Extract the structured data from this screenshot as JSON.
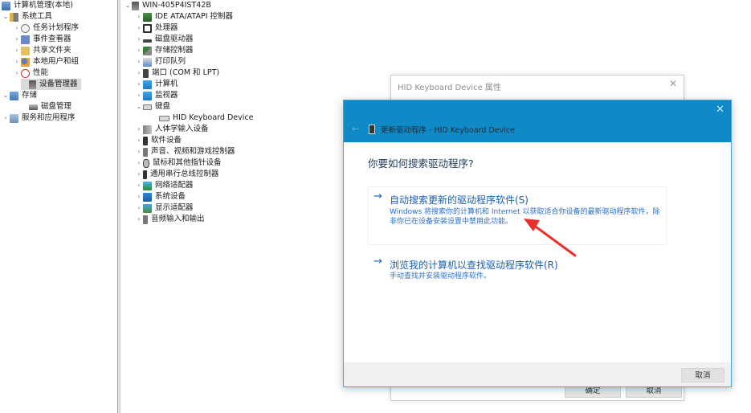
{
  "left_tree": {
    "root": "计算机管理(本地)",
    "items": [
      {
        "label": "系统工具",
        "expanded": true
      },
      {
        "label": "任务计划程序"
      },
      {
        "label": "事件查看器"
      },
      {
        "label": "共享文件夹"
      },
      {
        "label": "本地用户和组"
      },
      {
        "label": "性能"
      },
      {
        "label": "设备管理器",
        "selected": true
      },
      {
        "label": "存储",
        "expanded": true
      },
      {
        "label": "磁盘管理"
      },
      {
        "label": "服务和应用程序"
      }
    ]
  },
  "device_tree": {
    "root": "WIN-405P4IST42B",
    "items": [
      {
        "label": "IDE ATA/ATAPI 控制器"
      },
      {
        "label": "处理器"
      },
      {
        "label": "磁盘驱动器"
      },
      {
        "label": "存储控制器"
      },
      {
        "label": "打印队列"
      },
      {
        "label": "端口 (COM 和 LPT)"
      },
      {
        "label": "计算机"
      },
      {
        "label": "监视器"
      },
      {
        "label": "键盘",
        "expanded": true
      },
      {
        "label": "HID Keyboard Device"
      },
      {
        "label": "人体学输入设备"
      },
      {
        "label": "软件设备"
      },
      {
        "label": "声音、视频和游戏控制器"
      },
      {
        "label": "鼠标和其他指针设备"
      },
      {
        "label": "通用串行总线控制器"
      },
      {
        "label": "网络适配器"
      },
      {
        "label": "系统设备"
      },
      {
        "label": "显示适配器"
      },
      {
        "label": "音频输入和输出"
      }
    ]
  },
  "properties_dialog": {
    "title": "HID Keyboard Device 属性",
    "close": "✕",
    "ok_label": "确定",
    "cancel_label": "取消"
  },
  "update_dialog": {
    "title": "更新驱动程序 - HID Keyboard Device",
    "close": "✕",
    "back": "←",
    "question": "你要如何搜索驱动程序?",
    "options": [
      {
        "arrow": "→",
        "title": "自动搜索更新的驱动程序软件(S)",
        "desc": "Windows 将搜索你的计算机和 Internet 以获取适合你设备的最新驱动程序软件，除非你已在设备安装设置中禁用此功能。"
      },
      {
        "arrow": "→",
        "title": "浏览我的计算机以查找驱动程序软件(R)",
        "desc": "手动查找并安装驱动程序软件。"
      }
    ],
    "cancel_label": "取消"
  },
  "colors": {
    "header_blue": "#0f8ac7",
    "link_blue": "#1a5fb4",
    "annotation_red": "#e8312a"
  }
}
